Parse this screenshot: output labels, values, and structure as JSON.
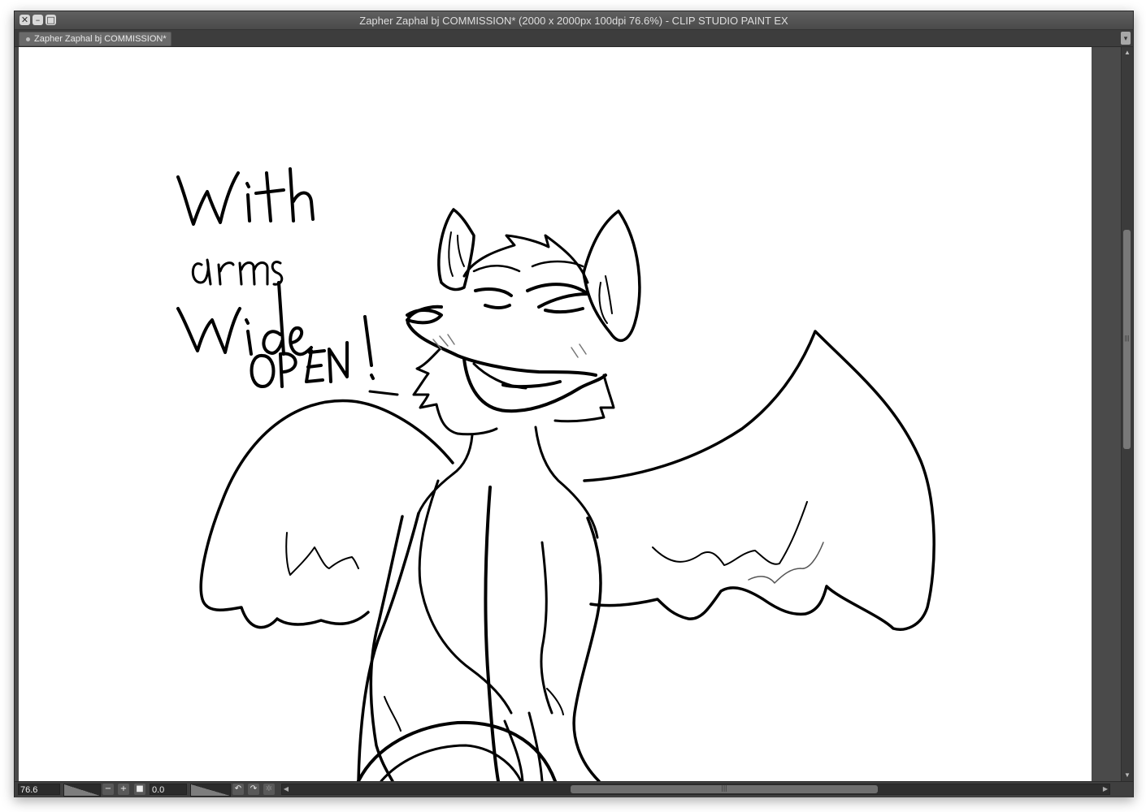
{
  "window": {
    "title": "Zapher Zaphal bj COMMISSION* (2000 x 2000px 100dpi 76.6%)  - CLIP STUDIO PAINT EX",
    "buttons": {
      "close": "✕",
      "minimize": "–",
      "maximize": "□"
    }
  },
  "tab": {
    "label": "Zapher Zaphal bj COMMISSION*",
    "dropdown": "▾"
  },
  "canvas": {
    "text_lines": [
      "With",
      "arms",
      "Wide",
      "OPEN!"
    ]
  },
  "statusbar": {
    "zoom_value": "76.6",
    "rotation_value": "0.0",
    "icons": {
      "zoom_out": "−",
      "zoom_in": "+",
      "fit": "■",
      "rotate_left": "↶",
      "rotate_right": "↷",
      "reset": "✲"
    }
  },
  "scrollbars": {
    "up": "▲",
    "down": "▼",
    "left": "◀",
    "right": "▶",
    "grip": "|||"
  }
}
